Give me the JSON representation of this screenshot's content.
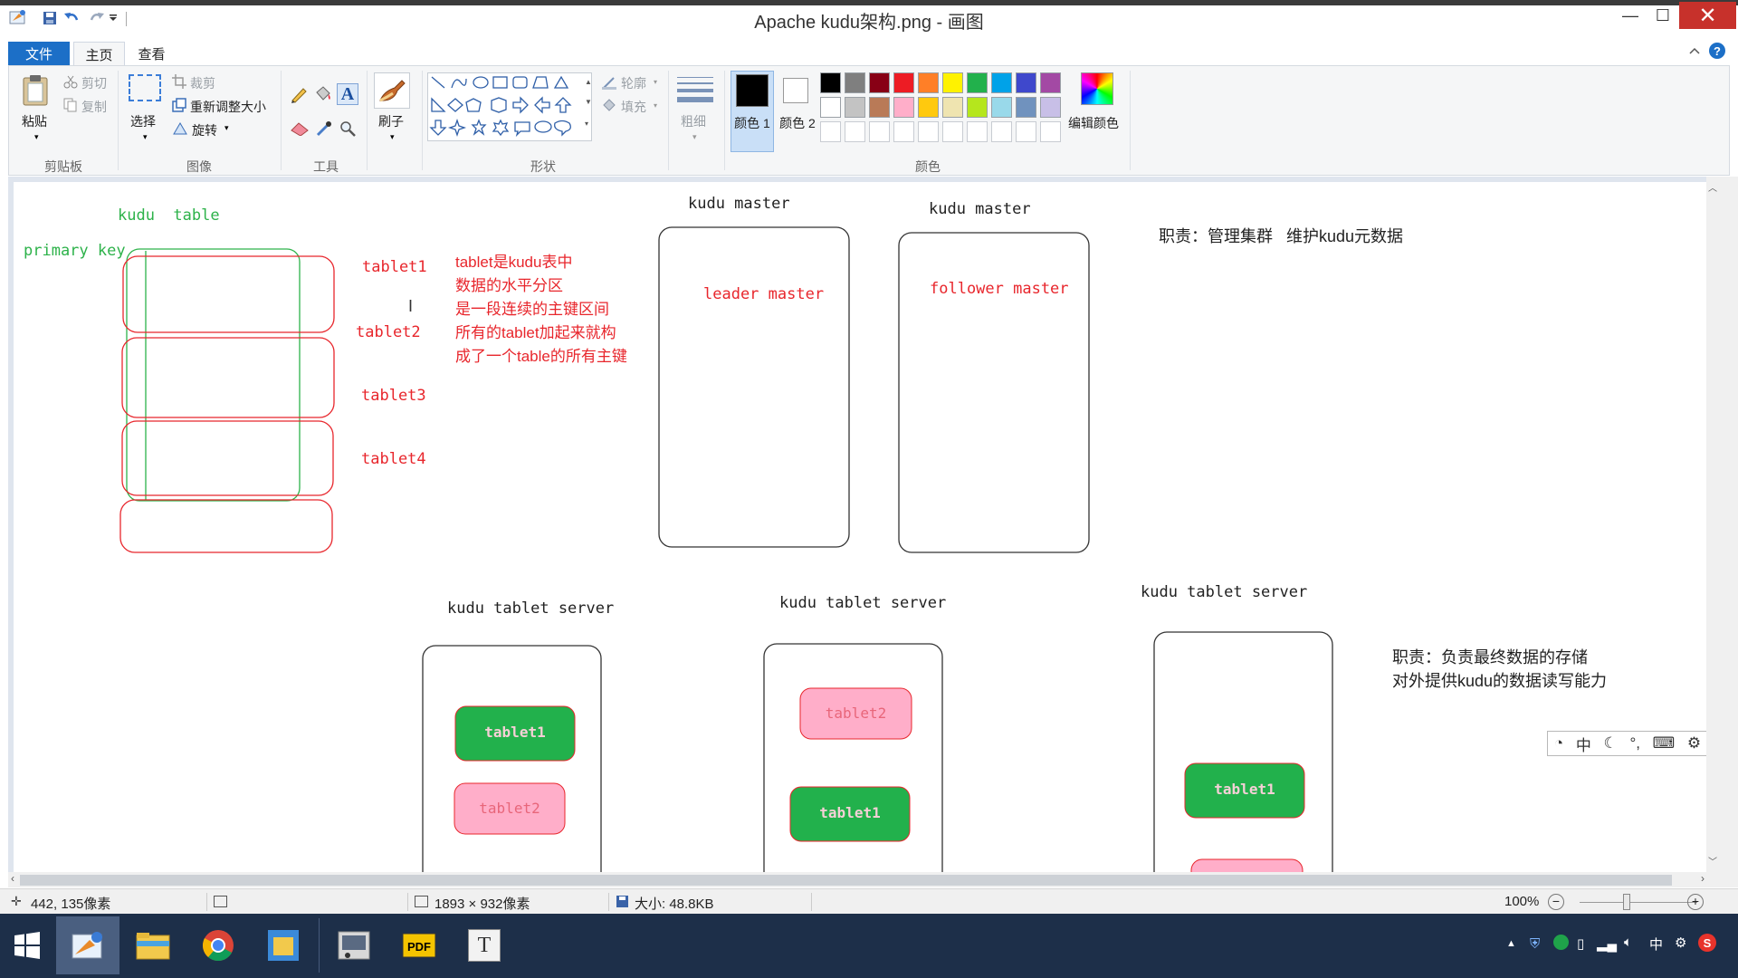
{
  "window": {
    "title": "Apache kudu架构.png - 画图",
    "minimize": "—",
    "maximize": "☐",
    "close": "✕"
  },
  "tabs": {
    "file": "文件",
    "home": "主页",
    "view": "查看"
  },
  "ribbon": {
    "clipboard": {
      "label": "剪贴板",
      "paste": "粘贴",
      "cut": "剪切",
      "copy": "复制"
    },
    "image": {
      "label": "图像",
      "select": "选择",
      "crop": "裁剪",
      "resize": "重新调整大小",
      "rotate": "旋转"
    },
    "tools": {
      "label": "工具"
    },
    "brush": {
      "label": "刷子"
    },
    "shapes": {
      "label": "形状",
      "outline": "轮廓",
      "fill": "填充"
    },
    "size": {
      "label": "粗细"
    },
    "colors": {
      "label": "颜色",
      "color1": "颜色 1",
      "color2": "颜色 2",
      "edit": "编辑颜色",
      "palette_row1": [
        "#000000",
        "#7f7f7f",
        "#880015",
        "#ed1c24",
        "#ff7f27",
        "#fff200",
        "#22b14c",
        "#00a2e8",
        "#3f48cc",
        "#a349a4"
      ],
      "palette_row2": [
        "#ffffff",
        "#c3c3c3",
        "#b97a57",
        "#ffaec9",
        "#ffc90e",
        "#efe4b0",
        "#b5e61d",
        "#99d9ea",
        "#7092be",
        "#c8bfe7"
      ]
    }
  },
  "drawing": {
    "kudu_table": "kudu  table",
    "primary_key": "primary key",
    "tablets": [
      "tablet1",
      "tablet2",
      "tablet3",
      "tablet4"
    ],
    "tablet_desc": [
      "tablet是kudu表中",
      "数据的水平分区",
      "是一段连续的主键区间",
      "所有的tablet加起来就构",
      "成了一个table的所有主键"
    ],
    "master1_title": "kudu master",
    "master1_label": "leader master",
    "master2_title": "kudu master",
    "master2_label": "follower master",
    "master_duty": "职责：管理集群   维护kudu元数据",
    "ts1_title": "kudu tablet server",
    "ts2_title": "kudu tablet server",
    "ts3_title": "kudu tablet server",
    "ts_duty": [
      "职责：负责最终数据的存储",
      "对外提供kudu的数据读写能力"
    ],
    "box_tablet1": "tablet1",
    "box_tablet2": "tablet2"
  },
  "ime": {
    "mode": "中"
  },
  "status": {
    "cursor": "442, 135像素",
    "dimensions": "1893 × 932像素",
    "size": "大小: 48.8KB",
    "zoom": "100%"
  },
  "tray": {
    "ime": "中"
  }
}
